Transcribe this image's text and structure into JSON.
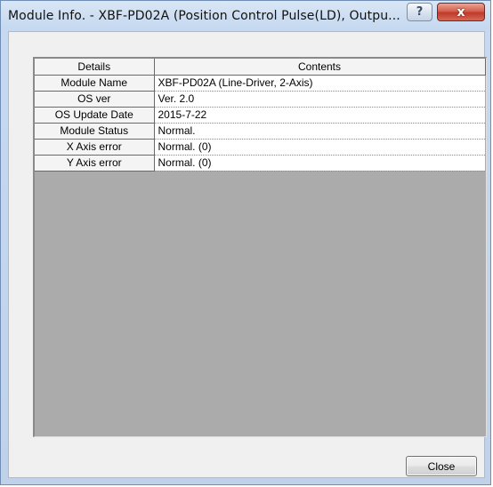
{
  "window": {
    "title": "Module Info. - XBF-PD02A (Position Control  Pulse(LD), Outpu...",
    "help_icon": "?",
    "close_icon": "x"
  },
  "table": {
    "headers": [
      "Details",
      "Contents"
    ],
    "rows": [
      {
        "label": "Module Name",
        "value": "XBF-PD02A (Line-Driver, 2-Axis)"
      },
      {
        "label": "OS ver",
        "value": "Ver.  2.0"
      },
      {
        "label": "OS Update Date",
        "value": "2015-7-22"
      },
      {
        "label": "Module Status",
        "value": "Normal."
      },
      {
        "label": "X Axis error",
        "value": "Normal. (0)"
      },
      {
        "label": "Y Axis error",
        "value": "Normal. (0)"
      }
    ]
  },
  "buttons": {
    "close_label": "Close"
  }
}
